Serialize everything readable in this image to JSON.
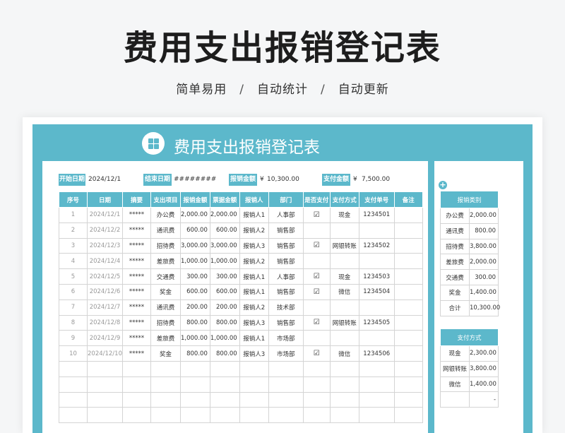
{
  "hero": {
    "title": "费用支出报销登记表",
    "tag1": "简单易用",
    "tag2": "自动统计",
    "tag3": "自动更新",
    "separator": "/"
  },
  "sheet": {
    "title": "费用支出报销登记表",
    "summary": {
      "start_label": "开始日期",
      "start_value": "2024/12/1",
      "end_label": "结束日期",
      "end_value": "########",
      "reimb_label": "报销金额",
      "reimb_currency": "¥",
      "reimb_value": "10,300.00",
      "paid_label": "支付金额",
      "paid_currency": "¥",
      "paid_value": "7,500.00"
    },
    "columns": [
      "序号",
      "日期",
      "摘要",
      "支出项目",
      "报销金额",
      "票据金额",
      "报销人",
      "部门",
      "是否支付",
      "支付方式",
      "支付单号",
      "备注"
    ],
    "rows": [
      [
        "1",
        "2024/12/1",
        "*****",
        "办公费",
        "2,000.00",
        "2,000.00",
        "报销人1",
        "人事部",
        "☑",
        "现金",
        "1234501",
        ""
      ],
      [
        "2",
        "2024/12/2",
        "*****",
        "通讯费",
        "600.00",
        "600.00",
        "报销人2",
        "销售部",
        "",
        "",
        "",
        ""
      ],
      [
        "3",
        "2024/12/3",
        "*****",
        "招待费",
        "3,000.00",
        "3,000.00",
        "报销人3",
        "销售部",
        "☑",
        "网银转账",
        "1234502",
        ""
      ],
      [
        "4",
        "2024/12/4",
        "*****",
        "差旅费",
        "1,000.00",
        "1,000.00",
        "报销人2",
        "销售部",
        "",
        "",
        "",
        ""
      ],
      [
        "5",
        "2024/12/5",
        "*****",
        "交通费",
        "300.00",
        "300.00",
        "报销人1",
        "人事部",
        "☑",
        "现金",
        "1234503",
        ""
      ],
      [
        "6",
        "2024/12/6",
        "*****",
        "奖金",
        "600.00",
        "600.00",
        "报销人1",
        "销售部",
        "☑",
        "微信",
        "1234504",
        ""
      ],
      [
        "7",
        "2024/12/7",
        "*****",
        "通讯费",
        "200.00",
        "200.00",
        "报销人2",
        "技术部",
        "",
        "",
        "",
        ""
      ],
      [
        "8",
        "2024/12/8",
        "*****",
        "招待费",
        "800.00",
        "800.00",
        "报销人3",
        "销售部",
        "☑",
        "网银转账",
        "1234505",
        ""
      ],
      [
        "9",
        "2024/12/9",
        "*****",
        "差旅费",
        "1,000.00",
        "1,000.00",
        "报销人1",
        "市场部",
        "",
        "",
        "",
        ""
      ],
      [
        "10",
        "2024/12/10",
        "*****",
        "奖金",
        "800.00",
        "800.00",
        "报销人3",
        "市场部",
        "☑",
        "微信",
        "1234506",
        ""
      ],
      [
        "",
        "",
        "",
        "",
        "",
        "",
        "",
        "",
        "",
        "",
        "",
        ""
      ],
      [
        "",
        "",
        "",
        "",
        "",
        "",
        "",
        "",
        "",
        "",
        "",
        ""
      ],
      [
        "",
        "",
        "",
        "",
        "",
        "",
        "",
        "",
        "",
        "",
        "",
        ""
      ],
      [
        "",
        "",
        "",
        "",
        "",
        "",
        "",
        "",
        "",
        "",
        "",
        ""
      ]
    ],
    "category_table": {
      "header": "报销类别",
      "rows": [
        [
          "办公费",
          "2,000.00"
        ],
        [
          "通讯费",
          "800.00"
        ],
        [
          "招待费",
          "3,800.00"
        ],
        [
          "差旅费",
          "2,000.00"
        ],
        [
          "交通费",
          "300.00"
        ],
        [
          "奖金",
          "1,400.00"
        ],
        [
          "合计",
          "10,300.00"
        ]
      ]
    },
    "payment_table": {
      "header": "支付方式",
      "rows": [
        [
          "现金",
          "2,300.00"
        ],
        [
          "网银转账",
          "3,800.00"
        ],
        [
          "微信",
          "1,400.00"
        ],
        [
          "",
          "-"
        ]
      ]
    },
    "plus_icon": "+"
  }
}
